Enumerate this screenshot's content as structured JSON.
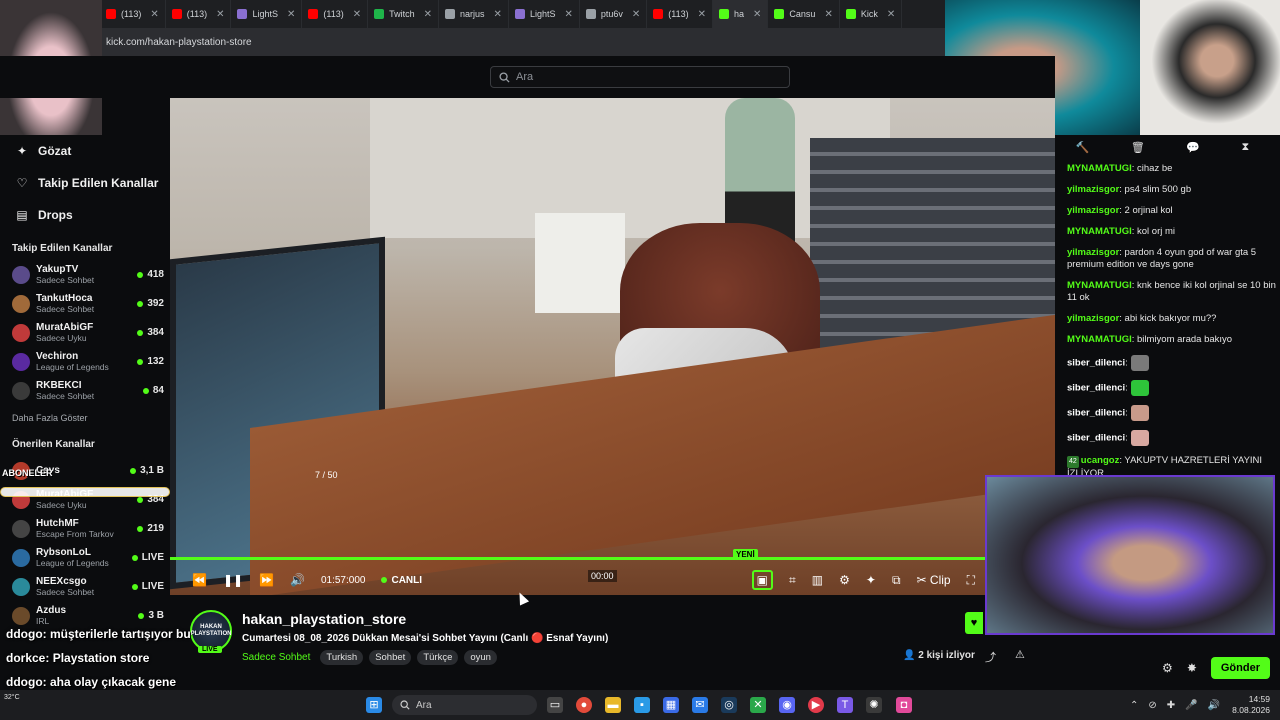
{
  "browser": {
    "tabs": [
      {
        "label": "(113)",
        "color": "#ff0000"
      },
      {
        "label": "(113)",
        "color": "#ff0000"
      },
      {
        "label": "LightS",
        "color": "#8a6fd1"
      },
      {
        "label": "(113)",
        "color": "#ff0000"
      },
      {
        "label": "Twitch",
        "color": "#1fb54a"
      },
      {
        "label": "narjus",
        "color": "#9aa0a6"
      },
      {
        "label": "LightS",
        "color": "#8a6fd1"
      },
      {
        "label": "ptu6v",
        "color": "#9aa0a6"
      },
      {
        "label": "(113)",
        "color": "#ff0000"
      },
      {
        "label": "ha",
        "color": "#53fc18"
      },
      {
        "label": "Cansu",
        "color": "#53fc18"
      },
      {
        "label": "Kick",
        "color": "#53fc18"
      }
    ],
    "url": "kick.com/hakan-playstation-store"
  },
  "topbar": {
    "search_placeholder": "Ara"
  },
  "sidebar": {
    "nav": [
      {
        "label": "Gözat",
        "icon": "compass-icon"
      },
      {
        "label": "Takip Edilen Kanallar",
        "icon": "heart-icon"
      },
      {
        "label": "Drops",
        "icon": "drops-icon"
      }
    ],
    "followed_title": "Takip Edilen Kanallar",
    "followed": [
      {
        "name": "YakupTV",
        "category": "Sadece Sohbet",
        "viewers": "418",
        "color": "#5a4b8a"
      },
      {
        "name": "TankutHoca",
        "category": "Sadece Sohbet",
        "viewers": "392",
        "color": "#a06a3a"
      },
      {
        "name": "MuratAbiGF",
        "category": "Sadece Uyku",
        "viewers": "384",
        "color": "#c03a3a"
      },
      {
        "name": "Vechiron",
        "category": "League of Legends",
        "viewers": "132",
        "color": "#5a2aa0"
      },
      {
        "name": "RKBEKCI",
        "category": "Sadece Sohbet",
        "viewers": "84",
        "color": "#3a3a3a"
      }
    ],
    "show_more": "Daha Fazla Göster",
    "recommended_title": "Önerilen Kanallar",
    "recommended": [
      {
        "name": "Cavs",
        "category": "",
        "viewers": "3,1 B",
        "color": "#b33a2a"
      },
      {
        "name": "MuratAbiGF",
        "category": "Sadece Uyku",
        "viewers": "384",
        "color": "#c03a3a"
      },
      {
        "name": "HutchMF",
        "category": "Escape From Tarkov",
        "viewers": "219",
        "color": "#444"
      },
      {
        "name": "RybsonLoL",
        "category": "League of Legends",
        "viewers": "LIVE",
        "color": "#2a6aa0"
      },
      {
        "name": "NEEXcsgo",
        "category": "Sadece Sohbet",
        "viewers": "LIVE",
        "color": "#2a8a9a"
      },
      {
        "name": "Azdus",
        "category": "IRL",
        "viewers": "3 B",
        "color": "#6a4a2a"
      }
    ]
  },
  "overlay": {
    "aboneler": "ABONELER",
    "sub_count": "7 / 50",
    "chat": [
      {
        "user": "ddogo",
        "text": ": müşterilerle tartışıyor bu"
      },
      {
        "user": "dorkce",
        "text": ": Playstation store"
      },
      {
        "user": "ddogo",
        "text": ": aha olay çıkacak gene"
      },
      {
        "user": "ddogo",
        "text": ":"
      }
    ]
  },
  "player": {
    "time": "01:57:000",
    "live": "CANLI",
    "seek_time": "00:00",
    "new_badge": "YENİ",
    "clip_label": "Clip"
  },
  "stream": {
    "avatar_text": "HAKAN PLAYSTATION",
    "live_badge": "LIVE",
    "channel": "hakan_playstation_store",
    "title": "Cumartesi 08_08_2026 Dükkan Mesai'si Sohbet Yayını (Canlı 🔴 Esnaf Yayını)",
    "category": "Sadece Sohbet",
    "tags": [
      "Turkish",
      "Sohbet",
      "Türkçe",
      "oyun"
    ],
    "watching": "2 kişi izliyor"
  },
  "chat": {
    "messages": [
      {
        "user": "MYNAMATUGI",
        "color": "#53fc18",
        "text": ": cihaz be",
        "emote": ""
      },
      {
        "user": "yilmazisgor",
        "color": "#53fc18",
        "text": ": ps4 slim 500 gb",
        "emote": ""
      },
      {
        "user": "yilmazisgor",
        "color": "#53fc18",
        "text": ": 2 orjinal kol",
        "emote": ""
      },
      {
        "user": "MYNAMATUGI",
        "color": "#53fc18",
        "text": ": kol orj mi",
        "emote": ""
      },
      {
        "user": "yilmazisgor",
        "color": "#53fc18",
        "text": ": pardon 4 oyun god of war gta 5 premium edition ve days gone",
        "emote": ""
      },
      {
        "user": "MYNAMATUGI",
        "color": "#53fc18",
        "text": ": knk bence iki kol orjinal se 10 bin 11 ok",
        "emote": ""
      },
      {
        "user": "yilmazisgor",
        "color": "#53fc18",
        "text": ": abi kick bakıyor mu??",
        "emote": ""
      },
      {
        "user": "MYNAMATUGI",
        "color": "#53fc18",
        "text": ": bilmiyom arada bakıyo",
        "emote": ""
      },
      {
        "user": "siber_dilenci",
        "color": "#ffffff",
        "text": ":",
        "emote": "#7a7a7a"
      },
      {
        "user": "siber_dilenci",
        "color": "#ffffff",
        "text": ":",
        "emote": "#2ec43a"
      },
      {
        "user": "siber_dilenci",
        "color": "#ffffff",
        "text": ":",
        "emote": "#c89a8a"
      },
      {
        "user": "siber_dilenci",
        "color": "#ffffff",
        "text": ":",
        "emote": "#d8a8a0"
      },
      {
        "user": "ucangoz",
        "color": "#53fc18",
        "text": ": YAKUPTV HAZRETLERİ YAYINI İZLİYOR",
        "emote": "",
        "level": "42"
      }
    ],
    "send_label": "Gönder"
  },
  "taskbar": {
    "search_placeholder": "Ara",
    "weather": "32°C",
    "time": "14:59",
    "date": "8.08.2026"
  }
}
